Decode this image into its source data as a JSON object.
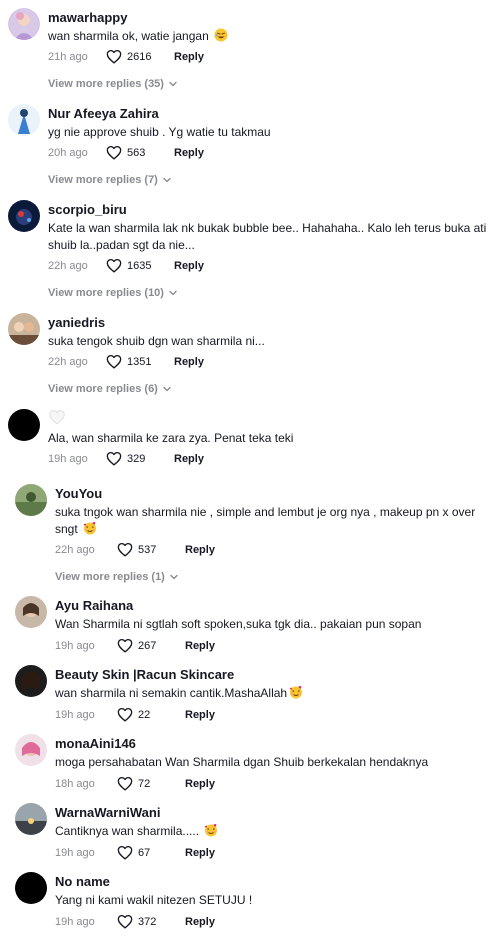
{
  "comments": [
    {
      "username": "mawarhappy",
      "text": "wan sharmila ok, watie jangan",
      "emoji": "rofl",
      "time": "21h ago",
      "likes": "2616",
      "reply": "Reply",
      "view_more": "View more replies (35)"
    },
    {
      "username": "Nur Afeeya Zahira",
      "text": "yg nie approve shuib . Yg watie tu takmau",
      "time": "20h ago",
      "likes": "563",
      "reply": "Reply",
      "view_more": "View more replies (7)"
    },
    {
      "username": "scorpio_biru",
      "text": "Kate la wan sharmila lak nk bukak bubble bee.. Hahahaha.. Kalo leh terus buka ati shuib la..padan sgt da nie...",
      "time": "22h ago",
      "likes": "1635",
      "reply": "Reply",
      "view_more": "View more replies (10)"
    },
    {
      "username": "yaniedris",
      "text": "suka tengok shuib dgn wan sharmila ni...",
      "time": "22h ago",
      "likes": "1351",
      "reply": "Reply",
      "view_more": "View more replies (6)"
    },
    {
      "username": "",
      "text": "Ala, wan sharmila ke zara zya. Penat teka teki",
      "time": "19h ago",
      "likes": "329",
      "reply": "Reply"
    },
    {
      "username": "YouYou",
      "text": "suka tngok wan sharmila nie , simple and lembut je org nya , makeup pn x over sngt",
      "emoji": "love",
      "time": "22h ago",
      "likes": "537",
      "reply": "Reply",
      "view_more": "View more replies (1)"
    },
    {
      "username": "Ayu Raihana",
      "text": "Wan Sharmila ni sgtlah soft spoken,suka tgk dia.. pakaian pun sopan",
      "time": "19h ago",
      "likes": "267",
      "reply": "Reply"
    },
    {
      "username": "Beauty Skin |Racun Skincare",
      "text": "wan sharmila ni semakin cantik.MashaAllah",
      "emoji": "love",
      "time": "19h ago",
      "likes": "22",
      "reply": "Reply"
    },
    {
      "username": "monaAini146",
      "text": "moga persahabatan Wan Sharmila dgan Shuib berkekalan hendaknya",
      "time": "18h ago",
      "likes": "72",
      "reply": "Reply"
    },
    {
      "username": "WarnaWarniWani",
      "text": "Cantiknya wan sharmila.....",
      "emoji": "love",
      "time": "19h ago",
      "likes": "67",
      "reply": "Reply"
    },
    {
      "username": "No name",
      "text": "Yang ni kami wakil nitezen SETUJU !",
      "time": "19h ago",
      "likes": "372",
      "reply": "Reply"
    }
  ],
  "colors": {
    "text": "#161823",
    "muted": "#8a8b91"
  },
  "icons": {
    "like": "heart-outline-icon",
    "expand": "chevron-down-icon"
  }
}
